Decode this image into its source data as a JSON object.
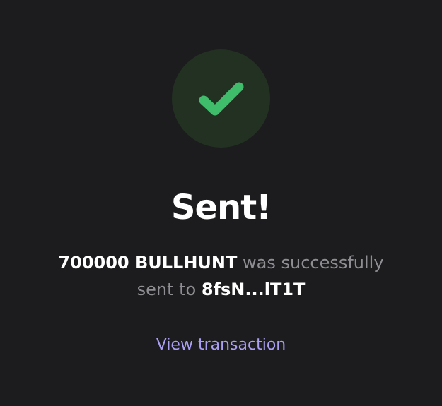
{
  "success": {
    "icon": "checkmark-icon",
    "icon_color": "#3fbd6b",
    "circle_color": "#233123"
  },
  "title": "Sent!",
  "message": {
    "amount": "700000 BULLHUNT",
    "middle_text": " was successfully sent to ",
    "recipient": "8fsN...lT1T"
  },
  "view_transaction_label": "View transaction",
  "colors": {
    "background": "#1c1c1e",
    "muted_text": "#8e8e93",
    "link": "#ab9ff2"
  }
}
